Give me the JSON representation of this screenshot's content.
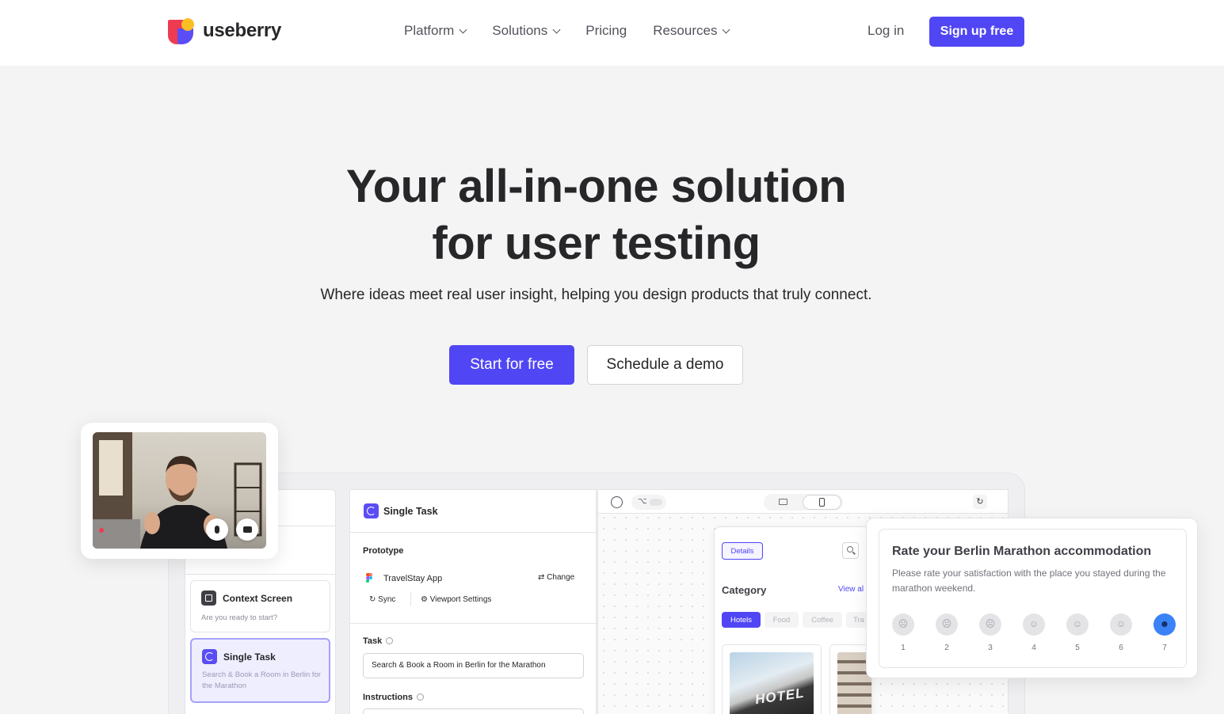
{
  "brand": {
    "name": "useberry"
  },
  "nav": {
    "menu": [
      {
        "label": "Platform",
        "dropdown": true
      },
      {
        "label": "Solutions",
        "dropdown": true
      },
      {
        "label": "Pricing",
        "dropdown": false
      },
      {
        "label": "Resources",
        "dropdown": true
      }
    ],
    "login": "Log in",
    "signup": "Sign up free"
  },
  "hero": {
    "title_line1": "Your all-in-one solution",
    "title_line2": "for user testing",
    "subtitle": "Where ideas meet real user insight, helping you design products that truly connect.",
    "primary_cta": "Start for free",
    "secondary_cta": "Schedule a demo"
  },
  "builder": {
    "blocks": [
      {
        "title": "Context Screen",
        "subtitle": "Are you ready to start?"
      },
      {
        "title": "Single Task",
        "subtitle": "Search & Book a Room in Berlin for the Marathon"
      }
    ],
    "panel": {
      "title": "Single Task",
      "prototype_label": "Prototype",
      "prototype_name": "TravelStay App",
      "change": "Change",
      "sync": "Sync",
      "viewport": "Viewport Settings",
      "task_label": "Task",
      "task_value": "Search & Book a Room in Berlin for the Marathon",
      "instructions_label": "Instructions"
    },
    "preview": {
      "details": "Details",
      "category": "Category",
      "view_all": "View al",
      "pills": [
        "Hotels",
        "Food",
        "Coffee",
        "Tra"
      ],
      "hotel_sign": "HOTEL"
    }
  },
  "rating": {
    "title": "Rate your Berlin Marathon accommodation",
    "subtitle": "Please rate your satisfaction with the place you stayed during the marathon weekend.",
    "scale": [
      "1",
      "2",
      "3",
      "4",
      "5",
      "6",
      "7"
    ],
    "selected": "7"
  },
  "colors": {
    "accent": "#5046f4",
    "background": "#f4f4f5",
    "selected_face": "#3b82f6"
  }
}
